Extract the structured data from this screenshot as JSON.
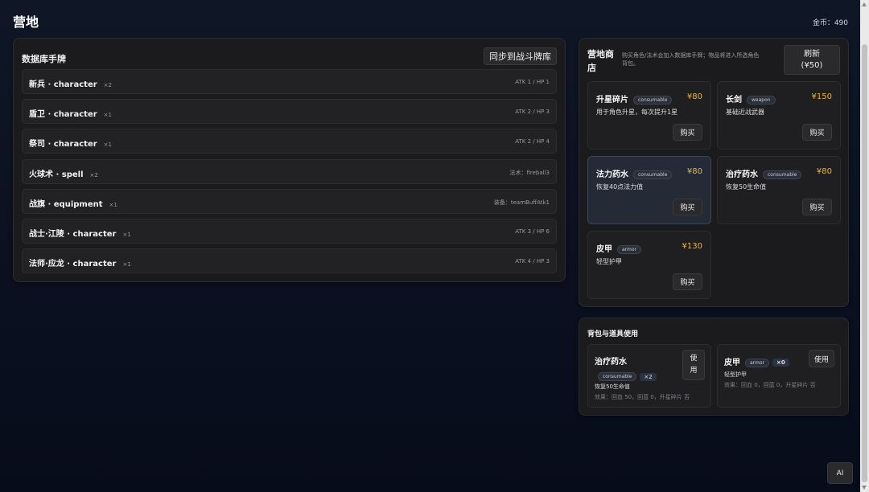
{
  "header": {
    "title": "营地",
    "coins": "金币：490"
  },
  "deck": {
    "title": "数据库手牌",
    "sync_label": "同步到战斗牌库",
    "rows": [
      {
        "name": "新兵 · character",
        "count": "×2",
        "stat": "ATK 1 / HP 1"
      },
      {
        "name": "盾卫 · character",
        "count": "×1",
        "stat": "ATK 2 / HP 3"
      },
      {
        "name": "祭司 · character",
        "count": "×1",
        "stat": "ATK 2 / HP 4"
      },
      {
        "name": "火球术 · spell",
        "count": "×2",
        "stat": "法术：fireball3"
      },
      {
        "name": "战旗 · equipment",
        "count": "×1",
        "stat": "装备：teamBuffAtk1"
      },
      {
        "name": "战士·江陵 · character",
        "count": "×1",
        "stat": "ATK 3 / HP 6"
      },
      {
        "name": "法师·应龙 · character",
        "count": "×1",
        "stat": "ATK 4 / HP 3"
      }
    ]
  },
  "shop": {
    "title": "营地商店",
    "description": "购买角色/法术会加入数据库手牌；物品将进入所选角色背包。",
    "refresh_label": "刷新",
    "refresh_cost": "(¥50)",
    "buy_label": "购买",
    "items": [
      {
        "name": "升星碎片",
        "tag": "consumable",
        "price": "¥80",
        "desc": "用于角色升星，每次提升1星"
      },
      {
        "name": "长剑",
        "tag": "weapon",
        "price": "¥150",
        "desc": "基础近战武器"
      },
      {
        "name": "法力药水",
        "tag": "consumable",
        "price": "¥80",
        "desc": "恢复40点法力值"
      },
      {
        "name": "治疗药水",
        "tag": "consumable",
        "price": "¥80",
        "desc": "恢复50生命值"
      },
      {
        "name": "皮甲",
        "tag": "armor",
        "price": "¥130",
        "desc": "轻型护甲"
      }
    ]
  },
  "bag": {
    "title": "背包与道具使用",
    "items": [
      {
        "name": "治疗药水",
        "tag": "consumable",
        "qty": "×2",
        "desc": "恢复50生命值",
        "effect": "效果：回血 50，回蓝 0，升星碎片 否",
        "use_label": "使用"
      },
      {
        "name": "皮甲",
        "tag": "armor",
        "qty": "×0",
        "desc": "轻型护甲",
        "effect": "效果：回血 0，回蓝 0，升星碎片 否",
        "use_label": "使用"
      }
    ]
  },
  "ai_label": "AI",
  "colors": {
    "price": "#e9b531",
    "background": "#0a1020",
    "panel": "#1b1b1d"
  }
}
